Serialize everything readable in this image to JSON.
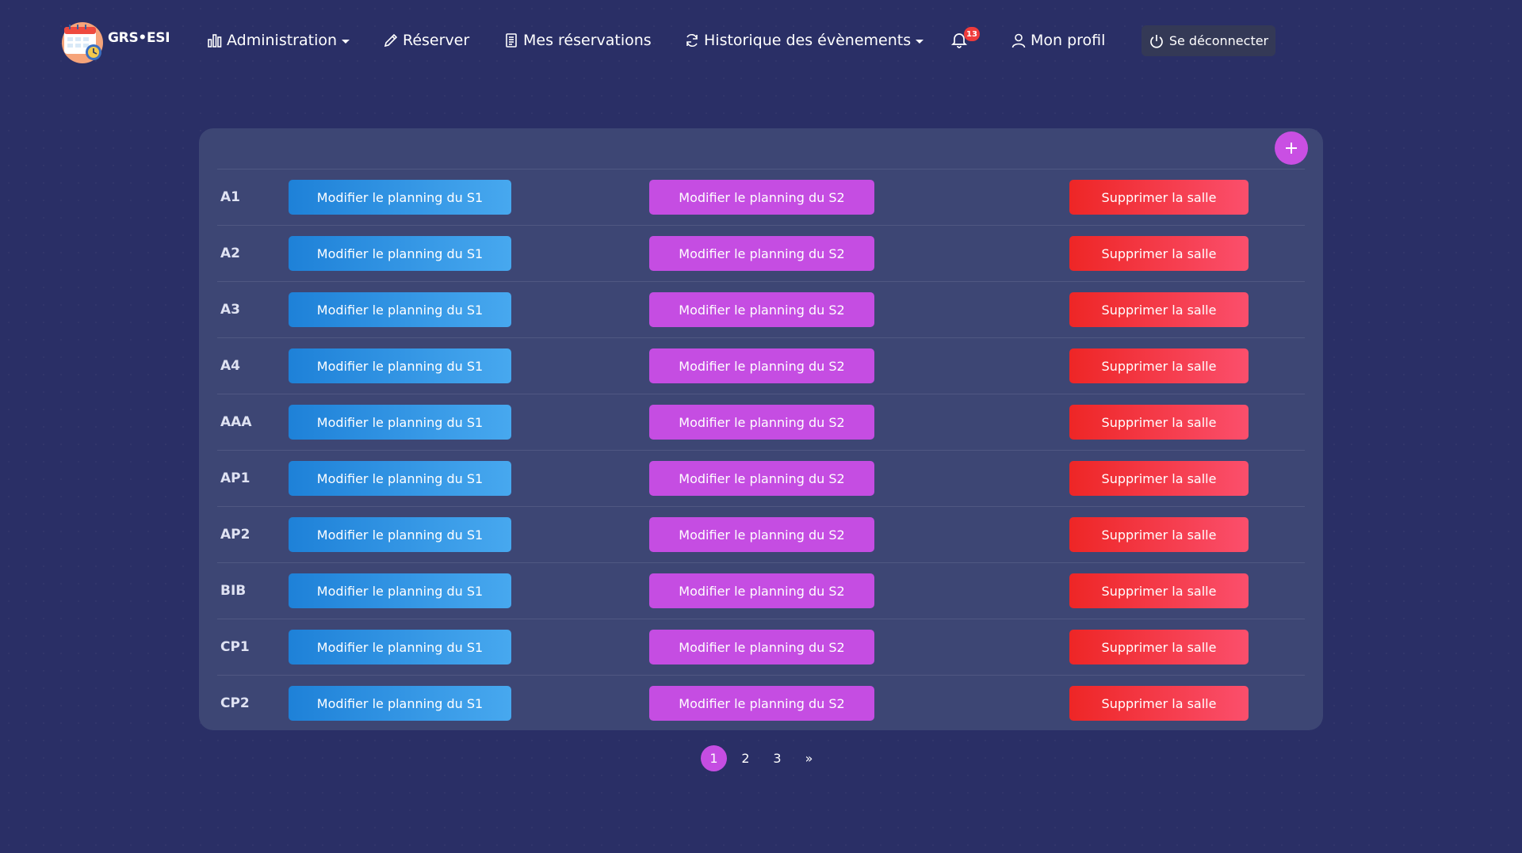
{
  "navbar": {
    "brand": "GRS•ESI",
    "items": [
      {
        "label": "Administration",
        "icon": "bar-chart-icon",
        "dropdown": true
      },
      {
        "label": "Réserver",
        "icon": "pencil-icon",
        "dropdown": false
      },
      {
        "label": "Mes réservations",
        "icon": "document-icon",
        "dropdown": false
      },
      {
        "label": "Historique des évènements",
        "icon": "refresh-icon",
        "dropdown": true
      },
      {
        "label": "Mon profil",
        "icon": "user-icon",
        "dropdown": false
      }
    ],
    "notifications": {
      "icon": "bell-icon",
      "count": "13"
    },
    "logout": {
      "label": "Se déconnecter",
      "icon": "power-icon"
    }
  },
  "table": {
    "add_icon": "plus-icon",
    "rows": [
      {
        "name": "A1",
        "s1": "Modifier le planning du S1",
        "s2": "Modifier le planning du S2",
        "delete": "Supprimer la salle"
      },
      {
        "name": "A2",
        "s1": "Modifier le planning du S1",
        "s2": "Modifier le planning du S2",
        "delete": "Supprimer la salle"
      },
      {
        "name": "A3",
        "s1": "Modifier le planning du S1",
        "s2": "Modifier le planning du S2",
        "delete": "Supprimer la salle"
      },
      {
        "name": "A4",
        "s1": "Modifier le planning du S1",
        "s2": "Modifier le planning du S2",
        "delete": "Supprimer la salle"
      },
      {
        "name": "AAA",
        "s1": "Modifier le planning du S1",
        "s2": "Modifier le planning du S2",
        "delete": "Supprimer la salle"
      },
      {
        "name": "AP1",
        "s1": "Modifier le planning du S1",
        "s2": "Modifier le planning du S2",
        "delete": "Supprimer la salle"
      },
      {
        "name": "AP2",
        "s1": "Modifier le planning du S1",
        "s2": "Modifier le planning du S2",
        "delete": "Supprimer la salle"
      },
      {
        "name": "BIB",
        "s1": "Modifier le planning du S1",
        "s2": "Modifier le planning du S2",
        "delete": "Supprimer la salle"
      },
      {
        "name": "CP1",
        "s1": "Modifier le planning du S1",
        "s2": "Modifier le planning du S2",
        "delete": "Supprimer la salle"
      },
      {
        "name": "CP2",
        "s1": "Modifier le planning du S1",
        "s2": "Modifier le planning du S2",
        "delete": "Supprimer la salle"
      }
    ]
  },
  "pagination": {
    "pages": [
      "1",
      "2",
      "3"
    ],
    "current": "1",
    "next": "»"
  },
  "colors": {
    "background": "#2a2f66",
    "card": "#3d4674",
    "primary_blue": "#2f90e2",
    "accent_purple": "#c54de2",
    "danger_red": "#f23a4a",
    "badge_red": "#ef3b3b"
  }
}
